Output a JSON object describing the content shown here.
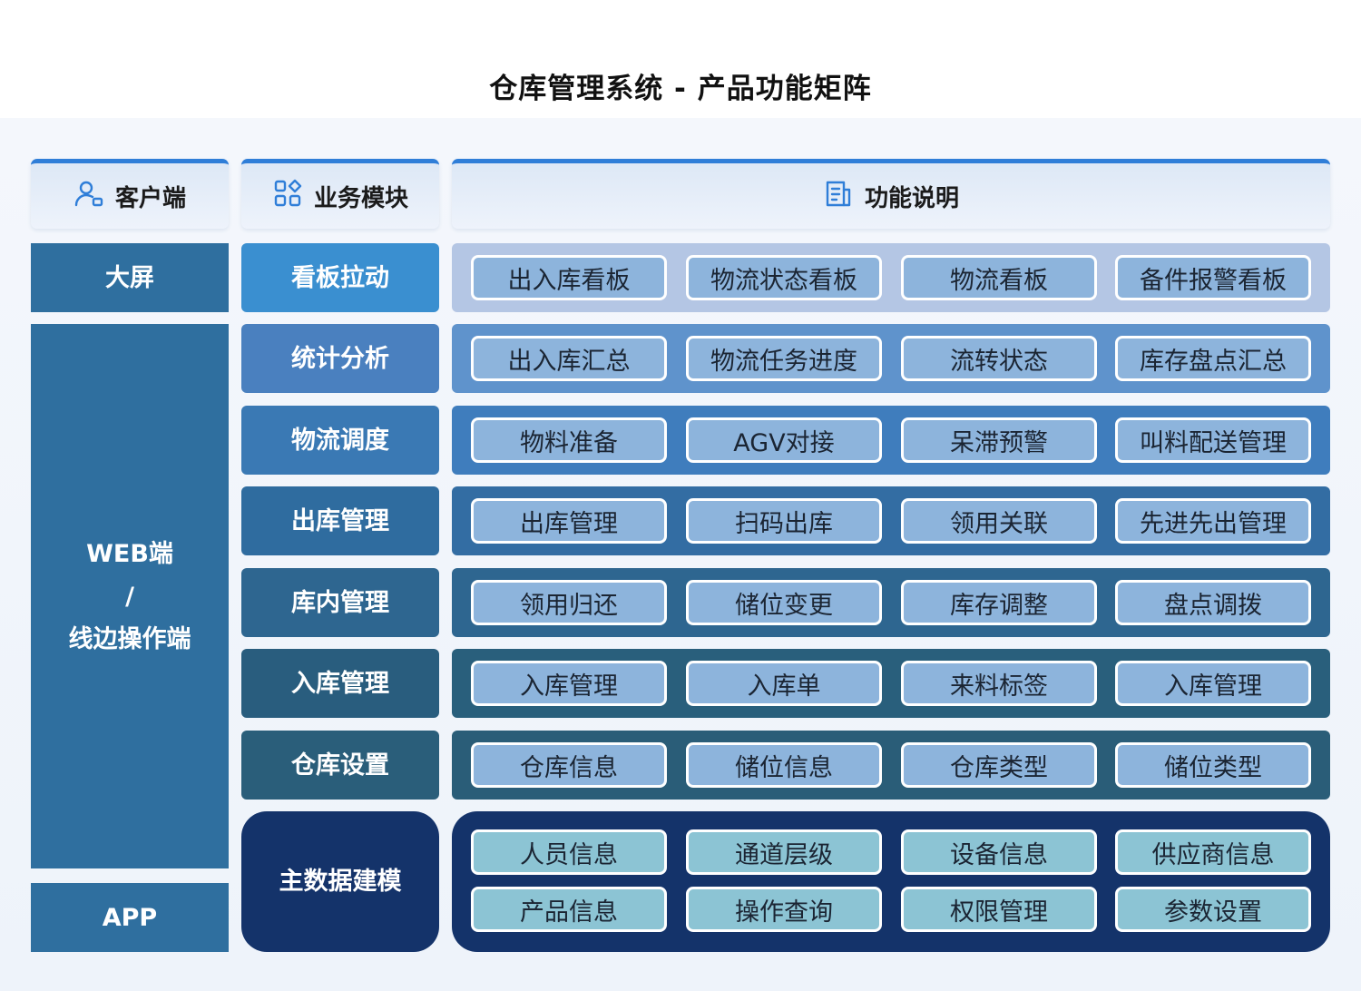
{
  "title": "仓库管理系统 - 产品功能矩阵",
  "headers": {
    "client": {
      "label": "客户端",
      "icon": "user-device-icon"
    },
    "module": {
      "label": "业务模块",
      "icon": "grid-apps-icon"
    },
    "function": {
      "label": "功能说明",
      "icon": "document-icon"
    }
  },
  "clients": [
    {
      "label": "大屏"
    },
    {
      "line1": "WEB端",
      "line2": "/",
      "line3": "线边操作端"
    },
    {
      "label": "APP"
    }
  ],
  "modules": [
    {
      "name": "看板拉动",
      "functions": [
        "出入库看板",
        "物流状态看板",
        "物流看板",
        "备件报警看板"
      ]
    },
    {
      "name": "统计分析",
      "functions": [
        "出入库汇总",
        "物流任务进度",
        "流转状态",
        "库存盘点汇总"
      ]
    },
    {
      "name": "物流调度",
      "functions": [
        "物料准备",
        "AGV对接",
        "呆滞预警",
        "叫料配送管理"
      ]
    },
    {
      "name": "出库管理",
      "functions": [
        "出库管理",
        "扫码出库",
        "领用关联",
        "先进先出管理"
      ]
    },
    {
      "name": "库内管理",
      "functions": [
        "领用归还",
        "储位变更",
        "库存调整",
        "盘点调拨"
      ]
    },
    {
      "name": "入库管理",
      "functions": [
        "入库管理",
        "入库单",
        "来料标签",
        "入库管理"
      ]
    },
    {
      "name": "仓库设置",
      "functions": [
        "仓库信息",
        "储位信息",
        "仓库类型",
        "储位类型"
      ]
    },
    {
      "name": "主数据建模",
      "functions": [
        "人员信息",
        "通道层级",
        "设备信息",
        "供应商信息",
        "产品信息",
        "操作查询",
        "权限管理",
        "参数设置"
      ]
    }
  ],
  "colors": {
    "header_accent": "#2f7ed8",
    "client_fill": "#2f6f9f",
    "module_fills": [
      "#3a8fd0",
      "#4a80bf",
      "#3a79b4",
      "#2f6c9f",
      "#2e6690",
      "#295d7e",
      "#2a5e7a",
      "#14336a"
    ],
    "row_fills": [
      "#b4c6e4",
      "#5f93cc",
      "#3f7dbd",
      "#336da3",
      "#2e6690",
      "#295f7c",
      "#2a5d78",
      "#14336a"
    ],
    "pill_fill": "#8db4dc",
    "master_pill_fill": "#8cc4d4"
  }
}
